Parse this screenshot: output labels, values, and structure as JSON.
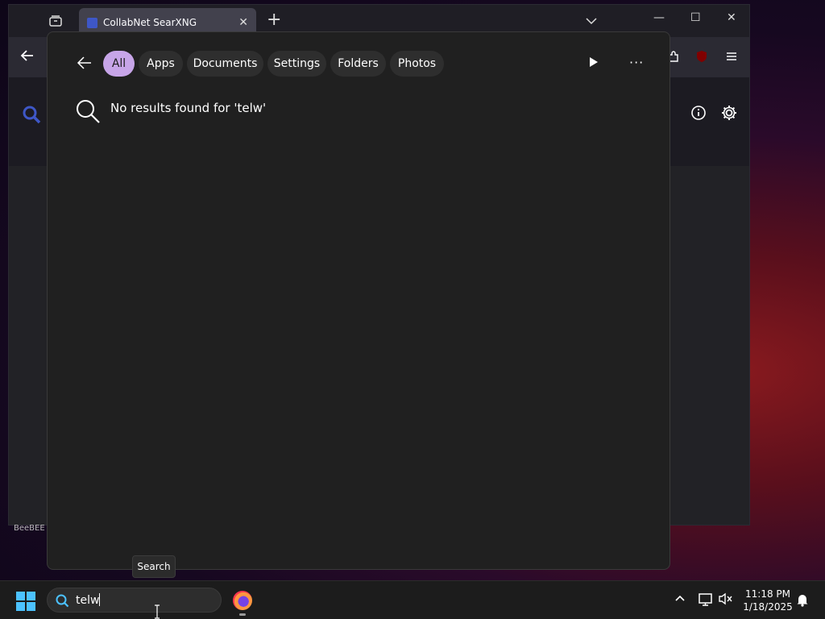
{
  "browser": {
    "tab_title": "CollabNet SearXNG",
    "footer_text": "BeeBEE"
  },
  "flyout": {
    "filters": [
      {
        "label": "All",
        "active": true
      },
      {
        "label": "Apps",
        "active": false
      },
      {
        "label": "Documents",
        "active": false
      },
      {
        "label": "Settings",
        "active": false
      },
      {
        "label": "Folders",
        "active": false
      },
      {
        "label": "Photos",
        "active": false
      }
    ],
    "no_results": "No results found for 'telw'"
  },
  "tooltip": "Search",
  "taskbar": {
    "search_value": "telw",
    "time": "11:18 PM",
    "date": "1/18/2025"
  },
  "colors": {
    "active_chip": "#c7a5e8",
    "accent_blue": "#4cc2ff",
    "searxng_blue": "#3e57c7"
  }
}
